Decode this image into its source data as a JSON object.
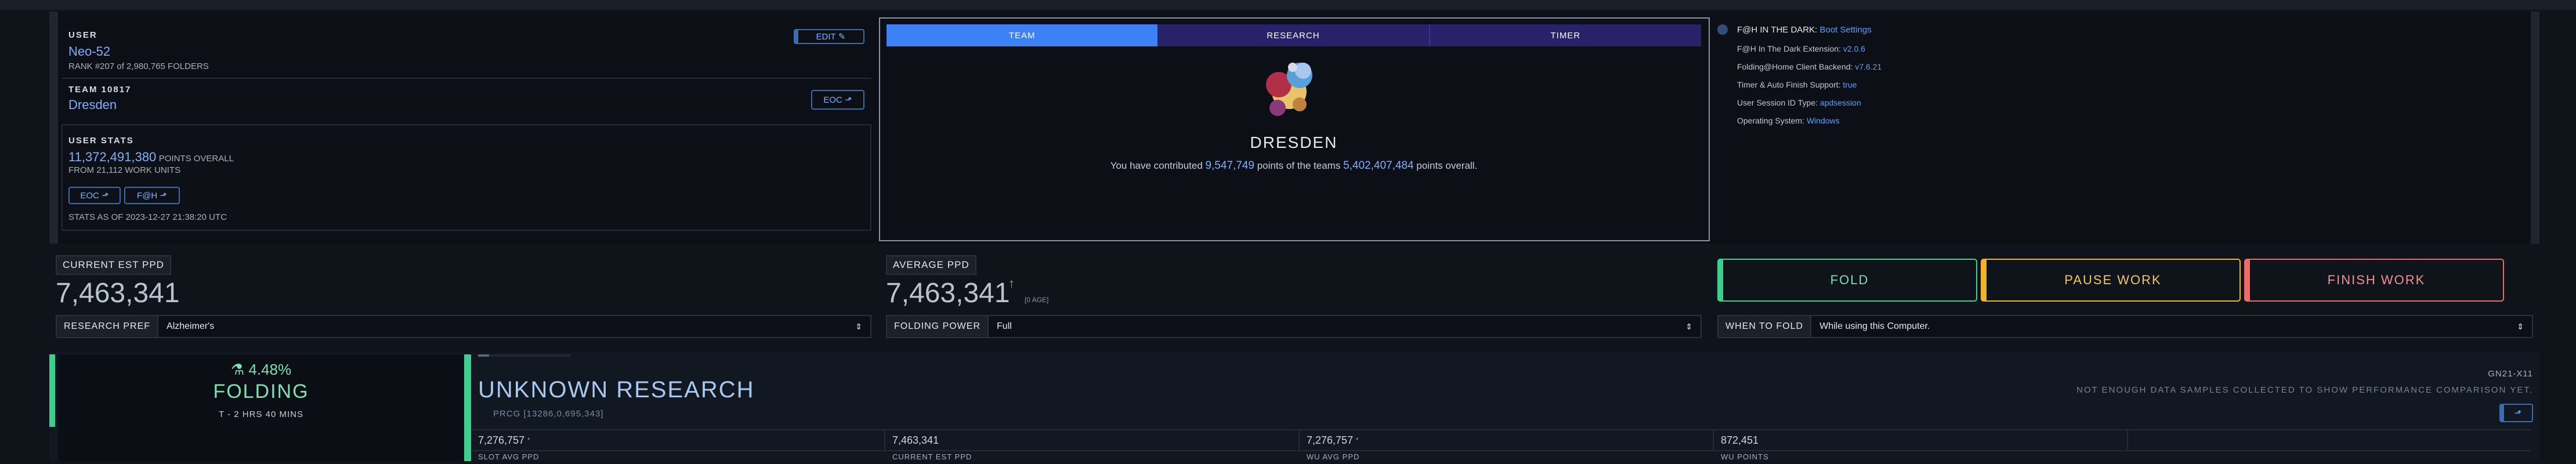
{
  "user": {
    "label": "USER",
    "name": "Neo-52",
    "rank": "RANK #207 of 2,980,765 FOLDERS",
    "edit_label": "EDIT"
  },
  "team": {
    "label": "TEAM 10817",
    "name": "Dresden",
    "eoc_label": "EOC"
  },
  "user_stats": {
    "label": "USER STATS",
    "points_value": "11,372,491,380",
    "points_suffix": "POINTS OVERALL",
    "work_units": "FROM 21,112 WORK UNITS",
    "eoc_label": "EOC",
    "fah_label": "F@H",
    "stats_as_of": "STATS AS OF 2023-12-27 21:38:20 UTC"
  },
  "center": {
    "tabs": [
      "TEAM",
      "RESEARCH",
      "TIMER"
    ],
    "team_name": "DRESDEN",
    "contrib_prefix": "You have contributed",
    "contrib_points": "9,547,749",
    "contrib_mid": "points of the teams",
    "team_points": "5,402,407,484",
    "contrib_suffix": "points overall."
  },
  "settings": {
    "title_prefix": "F@H IN THE DARK:",
    "title_link": "Boot Settings",
    "lines": [
      {
        "k": "F@H In The Dark Extension:",
        "v": "v2.0.6"
      },
      {
        "k": "Folding@Home Client Backend:",
        "v": "v7.6.21"
      },
      {
        "k": "Timer & Auto Finish Support:",
        "v": "true"
      },
      {
        "k": "User Session ID Type:",
        "v": "apdsession"
      },
      {
        "k": "Operating System:",
        "v": "Windows"
      }
    ]
  },
  "ppd": {
    "current_label": "CURRENT EST PPD",
    "current_value": "7,463,341",
    "avg_label": "AVERAGE PPD",
    "avg_value": "7,463,341",
    "avg_age": "[0 AGE]"
  },
  "controls": {
    "research_pref_label": "RESEARCH PREF",
    "research_pref_value": "Alzheimer's",
    "folding_power_label": "FOLDING POWER",
    "folding_power_value": "Full",
    "when_to_fold_label": "WHEN TO FOLD",
    "when_to_fold_value": "While using this Computer."
  },
  "actions": {
    "fold": "FOLD",
    "pause": "PAUSE WORK",
    "finish": "FINISH WORK",
    "fold_color": "#3ecf8e",
    "pause_color": "#f0b429",
    "finish_color": "#f06a6a"
  },
  "work": {
    "percent": "4.48%",
    "progress_fraction": 0.0448,
    "state": "FOLDING",
    "eta": "T - 2 HRS 40 MINS",
    "research_title": "UNKNOWN RESEARCH",
    "project": "PRCG [13286,0,695,343]",
    "gpu_id": "GN21-X11",
    "compare_note": "NOT ENOUGH DATA SAMPLES COLLECTED TO SHOW PERFORMANCE COMPARISON YET.",
    "row_values": [
      "7,276,757",
      "7,463,341",
      "7,276,757",
      "872,451"
    ],
    "row_headers": [
      "SLOT AVG PPD",
      "CURRENT EST PPD",
      "WU AVG PPD",
      "WU POINTS"
    ]
  }
}
